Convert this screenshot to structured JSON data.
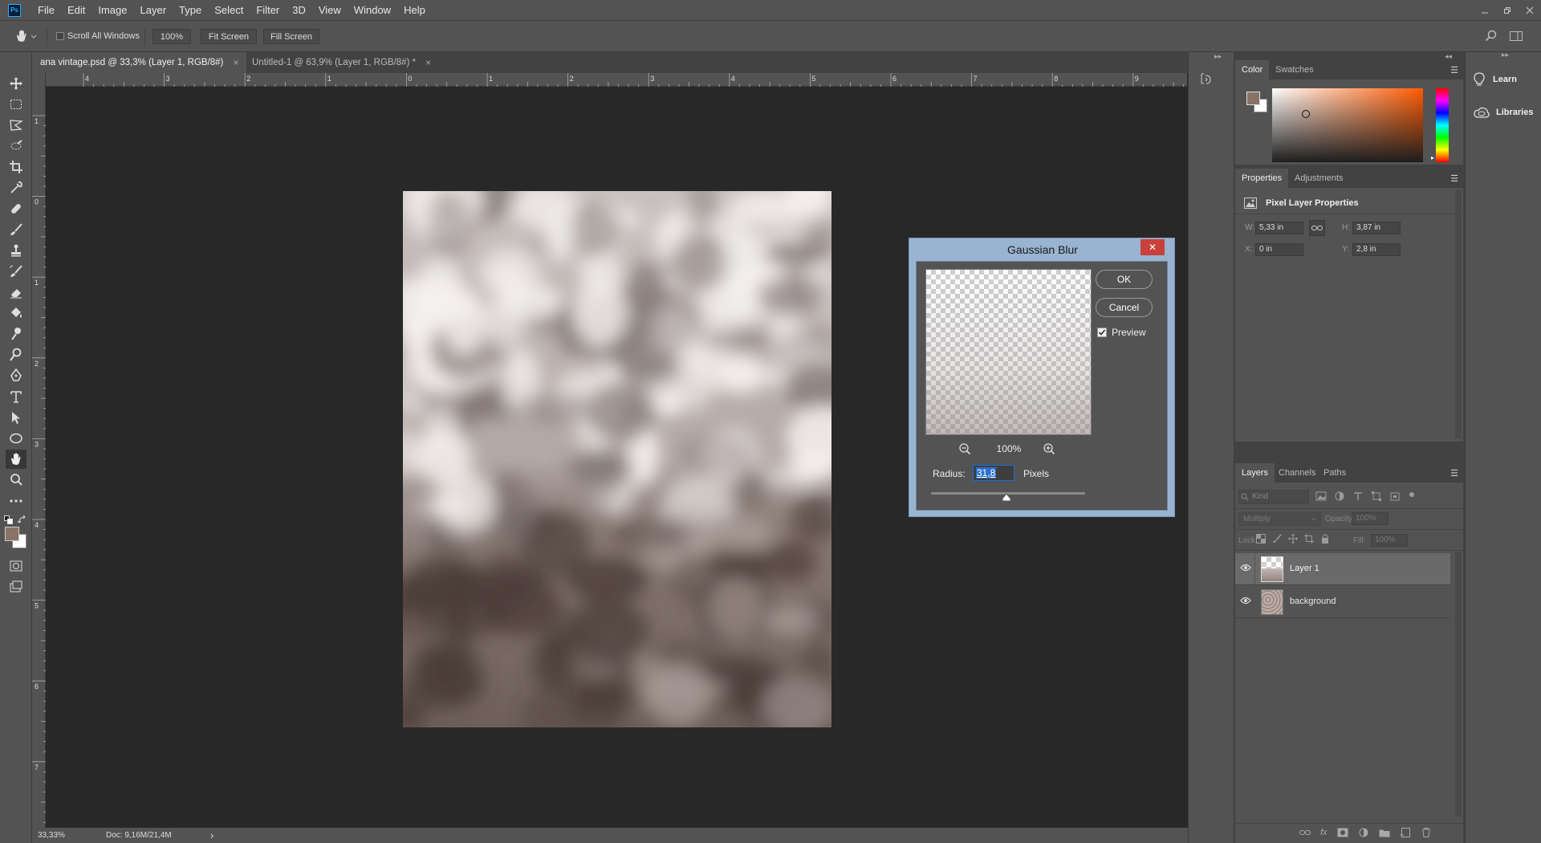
{
  "app": {
    "logo": "Ps"
  },
  "menu": [
    "File",
    "Edit",
    "Image",
    "Layer",
    "Type",
    "Select",
    "Filter",
    "3D",
    "View",
    "Window",
    "Help"
  ],
  "options": {
    "scroll_all_windows": "Scroll All Windows",
    "zoom_btn": "100%",
    "fit_screen": "Fit Screen",
    "fill_screen": "Fill Screen"
  },
  "tabs": [
    {
      "label": "ana vintage.psd @ 33,3% (Layer 1, RGB/8#)",
      "close": "×"
    },
    {
      "label": "Untitled-1 @ 63,9% (Layer 1, RGB/8#) *",
      "close": "×"
    }
  ],
  "rulers": {
    "h_labels": [
      "4",
      "3",
      "2",
      "1",
      "0",
      "1",
      "2",
      "3",
      "4",
      "5",
      "6",
      "7",
      "8",
      "9"
    ],
    "v_labels": [
      "1",
      "0",
      "1",
      "2",
      "3",
      "4",
      "5",
      "6",
      "7"
    ]
  },
  "status": {
    "zoom": "33,33%",
    "doc": "Doc: 9,16M/21,4M",
    "arrow": "›"
  },
  "dialog": {
    "title": "Gaussian Blur",
    "close": "✕",
    "ok": "OK",
    "cancel": "Cancel",
    "preview_label": "Preview",
    "preview_checked": true,
    "zoom": "100%",
    "radius_label": "Radius:",
    "radius_value": "31,8",
    "unit": "Pixels"
  },
  "color_panel": {
    "tabs": [
      "Color",
      "Swatches"
    ],
    "foreground": "#8a7366",
    "background": "#ffffff",
    "hue_color": "#ff5a00"
  },
  "properties": {
    "tabs": [
      "Properties",
      "Adjustments"
    ],
    "title": "Pixel Layer Properties",
    "w_label": "W:",
    "w": "5,33 in",
    "h_label": "H:",
    "h": "3,87 in",
    "x_label": "X:",
    "x": "0 in",
    "y_label": "Y:",
    "y": "2,8 in"
  },
  "layers_panel": {
    "tabs": [
      "Layers",
      "Channels",
      "Paths"
    ],
    "kind": "Kind",
    "blend": "Multiply",
    "opacity_label": "Opacity:",
    "opacity": "100%",
    "lock_label": "Lock:",
    "fill_label": "Fill:",
    "fill": "100%",
    "layers": [
      {
        "name": "Layer 1",
        "selected": true
      },
      {
        "name": "background",
        "selected": false
      }
    ]
  },
  "learn": {
    "learn": "Learn",
    "libraries": "Libraries"
  }
}
